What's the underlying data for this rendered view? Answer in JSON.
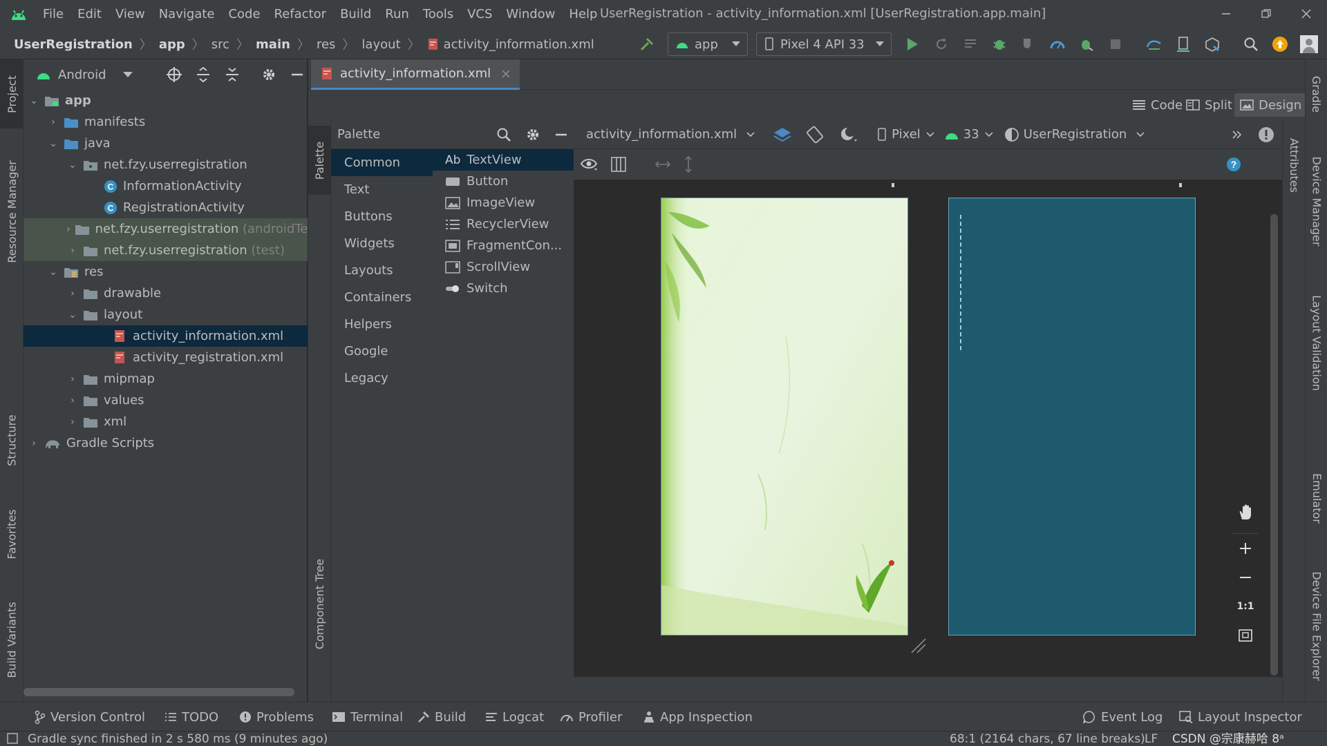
{
  "menu": [
    "File",
    "Edit",
    "View",
    "Navigate",
    "Code",
    "Refactor",
    "Build",
    "Run",
    "Tools",
    "VCS",
    "Window",
    "Help"
  ],
  "window_title": "UserRegistration - activity_information.xml [UserRegistration.app.main]",
  "breadcrumb": [
    "UserRegistration",
    "app",
    "src",
    "main",
    "res",
    "layout",
    "activity_information.xml"
  ],
  "toolbar": {
    "run_config": "app",
    "device": "Pixel 4 API 33"
  },
  "project": {
    "view_selector": "Android",
    "tree": [
      {
        "label": "app",
        "hint": ""
      },
      {
        "label": "manifests",
        "hint": ""
      },
      {
        "label": "java",
        "hint": ""
      },
      {
        "label": "net.fzy.userregistration",
        "hint": ""
      },
      {
        "label": "InformationActivity",
        "hint": ""
      },
      {
        "label": "RegistrationActivity",
        "hint": ""
      },
      {
        "label": "net.fzy.userregistration",
        "hint": "(androidTes"
      },
      {
        "label": "net.fzy.userregistration",
        "hint": "(test)"
      },
      {
        "label": "res",
        "hint": ""
      },
      {
        "label": "drawable",
        "hint": ""
      },
      {
        "label": "layout",
        "hint": ""
      },
      {
        "label": "activity_information.xml",
        "hint": ""
      },
      {
        "label": "activity_registration.xml",
        "hint": ""
      },
      {
        "label": "mipmap",
        "hint": ""
      },
      {
        "label": "values",
        "hint": ""
      },
      {
        "label": "xml",
        "hint": ""
      },
      {
        "label": "Gradle Scripts",
        "hint": ""
      }
    ]
  },
  "editor": {
    "tab": "activity_information.xml",
    "modes": {
      "code": "Code",
      "split": "Split",
      "design": "Design"
    }
  },
  "palette": {
    "title": "Palette",
    "categories": [
      "Common",
      "Text",
      "Buttons",
      "Widgets",
      "Layouts",
      "Containers",
      "Helpers",
      "Google",
      "Legacy"
    ],
    "items": [
      "TextView",
      "Button",
      "ImageView",
      "RecyclerView",
      "FragmentCon...",
      "ScrollView",
      "Switch"
    ],
    "textview_prefix": "Ab"
  },
  "design_toolbar": {
    "file": "activity_information.xml",
    "device": "Pixel",
    "api": "33",
    "theme": "UserRegistration"
  },
  "canvas": {
    "zoom_actual": "1:1",
    "blueprint_color": "#1e5a6e",
    "design_bg": "#dcefc8"
  },
  "side_tabs": {
    "left": [
      "Project",
      "Resource Manager",
      "Structure",
      "Favorites",
      "Build Variants"
    ],
    "right": [
      "Gradle",
      "Device Manager",
      "Layout Validation",
      "Emulator",
      "Device File Explorer"
    ],
    "palette_stripe": [
      "Palette",
      "Component Tree"
    ],
    "attributes": "Attributes"
  },
  "bottom_tools": [
    "Version Control",
    "TODO",
    "Problems",
    "Terminal",
    "Build",
    "Logcat",
    "Profiler",
    "App Inspection",
    "Event Log",
    "Layout Inspector"
  ],
  "status": {
    "message": "Gradle sync finished in 2 s 580 ms (9 minutes ago)",
    "position": "68:1 (2164 chars, 67 line breaks)",
    "line_sep": "LF",
    "watermark": "CSDN @宗康赫哈 8ᵃ"
  }
}
